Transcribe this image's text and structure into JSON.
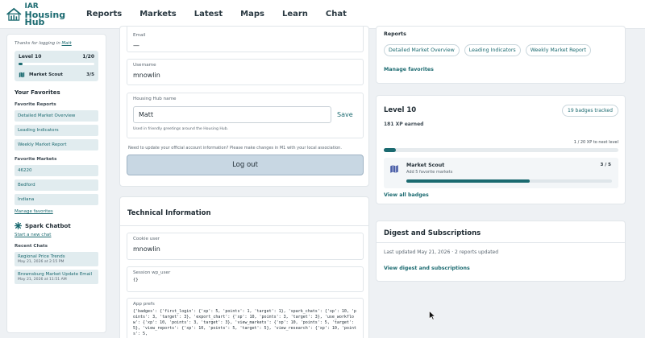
{
  "header": {
    "logo_line1": "IAR",
    "logo_line2": "Housing Hub",
    "nav": [
      "Reports",
      "Markets",
      "Latest",
      "Maps",
      "Learn",
      "Chat"
    ]
  },
  "sidebar": {
    "thanks_prefix": "Thanks for logging in",
    "thanks_user": "Matt",
    "level_label": "Level 10",
    "level_progress_text": "1/20",
    "level_progress": 0.05,
    "badge_name": "Market Scout",
    "badge_progress_text": "3/5",
    "favorites_title": "Your Favorites",
    "favorite_reports_label": "Favorite Reports",
    "favorite_reports": [
      "Detailed Market Overview",
      "Leading Indicators",
      "Weekly Market Report"
    ],
    "favorite_markets_label": "Favorite Markets",
    "favorite_markets": [
      "46220",
      "Bedford",
      "Indiana"
    ],
    "manage_favorites": "Manage favorites",
    "chatbot_title": "Spark Chatbot",
    "new_chat": "Start a new chat",
    "recent_chats_label": "Recent Chats",
    "recent_chats": [
      {
        "title": "Regional Price Trends",
        "date": "May 21, 2026 at 2:15 PM"
      },
      {
        "title": "Brownsburg Market Update Email",
        "date": "May 21, 2026 at 11:51 AM"
      }
    ]
  },
  "profile": {
    "email_label": "Email",
    "email_value": "—",
    "username_label": "Username",
    "username_value": "mnowlin",
    "hub_name_label": "Housing Hub name",
    "hub_name_value": "Matt",
    "save_label": "Save",
    "hub_name_hint": "Used in friendly greetings around the Housing Hub.",
    "update_note": "Need to update your official account information? Please make changes in M1 with your local association.",
    "logout_label": "Log out"
  },
  "technical": {
    "title": "Technical Information",
    "cookie_user_label": "Cookie user",
    "cookie_user_value": "mnowlin",
    "session_label": "Session wp_user",
    "session_value": "{}",
    "prefs_label": "App prefs",
    "prefs_value": "{'badges': {'first_login': {'xp': 5, 'points': 1, 'target': 1}, 'spark_chats': {'xp': 10, 'points': 3, 'target': 3}, 'export_chart': {'xp': 10, 'points': 3, 'target': 3}, 'use_workflow': {'xp': 10, 'points': 3, 'target': 3}, 'view_markets': {'xp': 10, 'points': 5, 'target': 5}, 'view_reports': {'xp': 10, 'points': 5, 'target': 5}, 'view_research': {'xp': 10, 'points': 5,"
  },
  "reports": {
    "label": "Reports",
    "pills": [
      "Detailed Market Overview",
      "Leading Indicators",
      "Weekly Market Report"
    ],
    "manage": "Manage favorites"
  },
  "level": {
    "title": "Level 10",
    "badges_tracked": "19 badges tracked",
    "xp_earned": "181 XP earned",
    "xp_next": "1 / 20 XP to next level",
    "xp_progress": 0.05,
    "badge_name": "Market Scout",
    "badge_desc": "Add 5 favorite markets",
    "badge_count": "3 / 5",
    "badge_progress": 0.6,
    "view_all": "View all badges"
  },
  "digest": {
    "title": "Digest and Subscriptions",
    "updated": "Last updated May 21, 2026 · 2 reports updated",
    "link": "View digest and subscriptions"
  },
  "colors": {
    "accent": "#1b6a70",
    "background": "#eef1f4",
    "chip_bg": "#e1ecef"
  }
}
